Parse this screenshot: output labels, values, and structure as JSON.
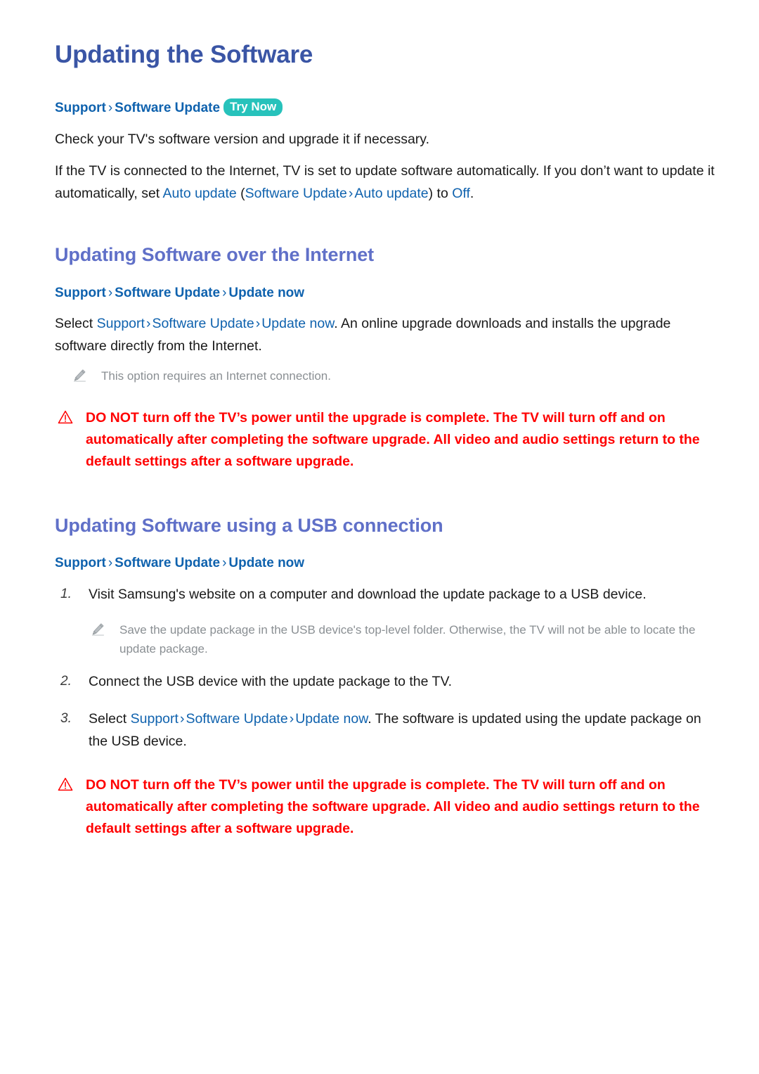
{
  "page": {
    "title": "Updating the Software"
  },
  "intro": {
    "breadcrumb": {
      "crumb1": "Support",
      "sep": "›",
      "crumb2": "Software Update",
      "badge": "Try Now"
    },
    "p1": "Check your TV's software version and upgrade it if necessary.",
    "p2_part1": "If the TV is connected to the Internet, TV is set to update software automatically. If you don’t want to update it automatically, set ",
    "p2_link1": "Auto update",
    "p2_paren_open": " (",
    "p2_link2": "Software Update",
    "p2_sep": "›",
    "p2_link3": "Auto update",
    "p2_paren_close": ") ",
    "p2_mid": "to ",
    "p2_link4": "Off",
    "p2_end": "."
  },
  "internet": {
    "heading": "Updating Software over the Internet",
    "breadcrumb": {
      "crumb1": "Support",
      "sep": "›",
      "crumb2": "Software Update",
      "crumb3": "Update now"
    },
    "p_prefix": "Select ",
    "p_link1": "Support",
    "p_sep1": "›",
    "p_link2": "Software Update",
    "p_sep2": "›",
    "p_link3": "Update now",
    "p_suffix": ". An online upgrade downloads and installs the upgrade software directly from the Internet.",
    "note": "This option requires an Internet connection.",
    "warning": "DO NOT turn off the TV’s power until the upgrade is complete. The TV will turn off and on automatically after completing the software upgrade. All video and audio settings return to the default settings after a software upgrade."
  },
  "usb": {
    "heading": "Updating Software using a USB connection",
    "breadcrumb": {
      "crumb1": "Support",
      "sep": "›",
      "crumb2": "Software Update",
      "crumb3": "Update now"
    },
    "steps": [
      {
        "num": "1.",
        "text": "Visit Samsung's website on a computer and download the update package to a USB device."
      },
      {
        "num": "2.",
        "text": "Connect the USB device with the update package to the TV."
      }
    ],
    "step1_note": "Save the update package in the USB device's top-level folder. Otherwise, the TV will not be able to locate the update package.",
    "step3": {
      "num": "3.",
      "prefix": "Select ",
      "link1": "Support",
      "sep1": "›",
      "link2": "Software Update",
      "sep2": "›",
      "link3": "Update now",
      "suffix": ". The software is updated using the update package on the USB device."
    },
    "warning": "DO NOT turn off the TV’s power until the upgrade is complete. The TV will turn off and on automatically after completing the software upgrade. All video and audio settings return to the default settings after a software upgrade."
  },
  "colors": {
    "title_blue": "#3a55a5",
    "heading_purple": "#6070c8",
    "link_blue": "#0f62ae",
    "badge_teal": "#27c2bb",
    "warning_red": "#ff0000",
    "note_gray": "#8a8f93",
    "body_text": "#1a1a1a"
  }
}
